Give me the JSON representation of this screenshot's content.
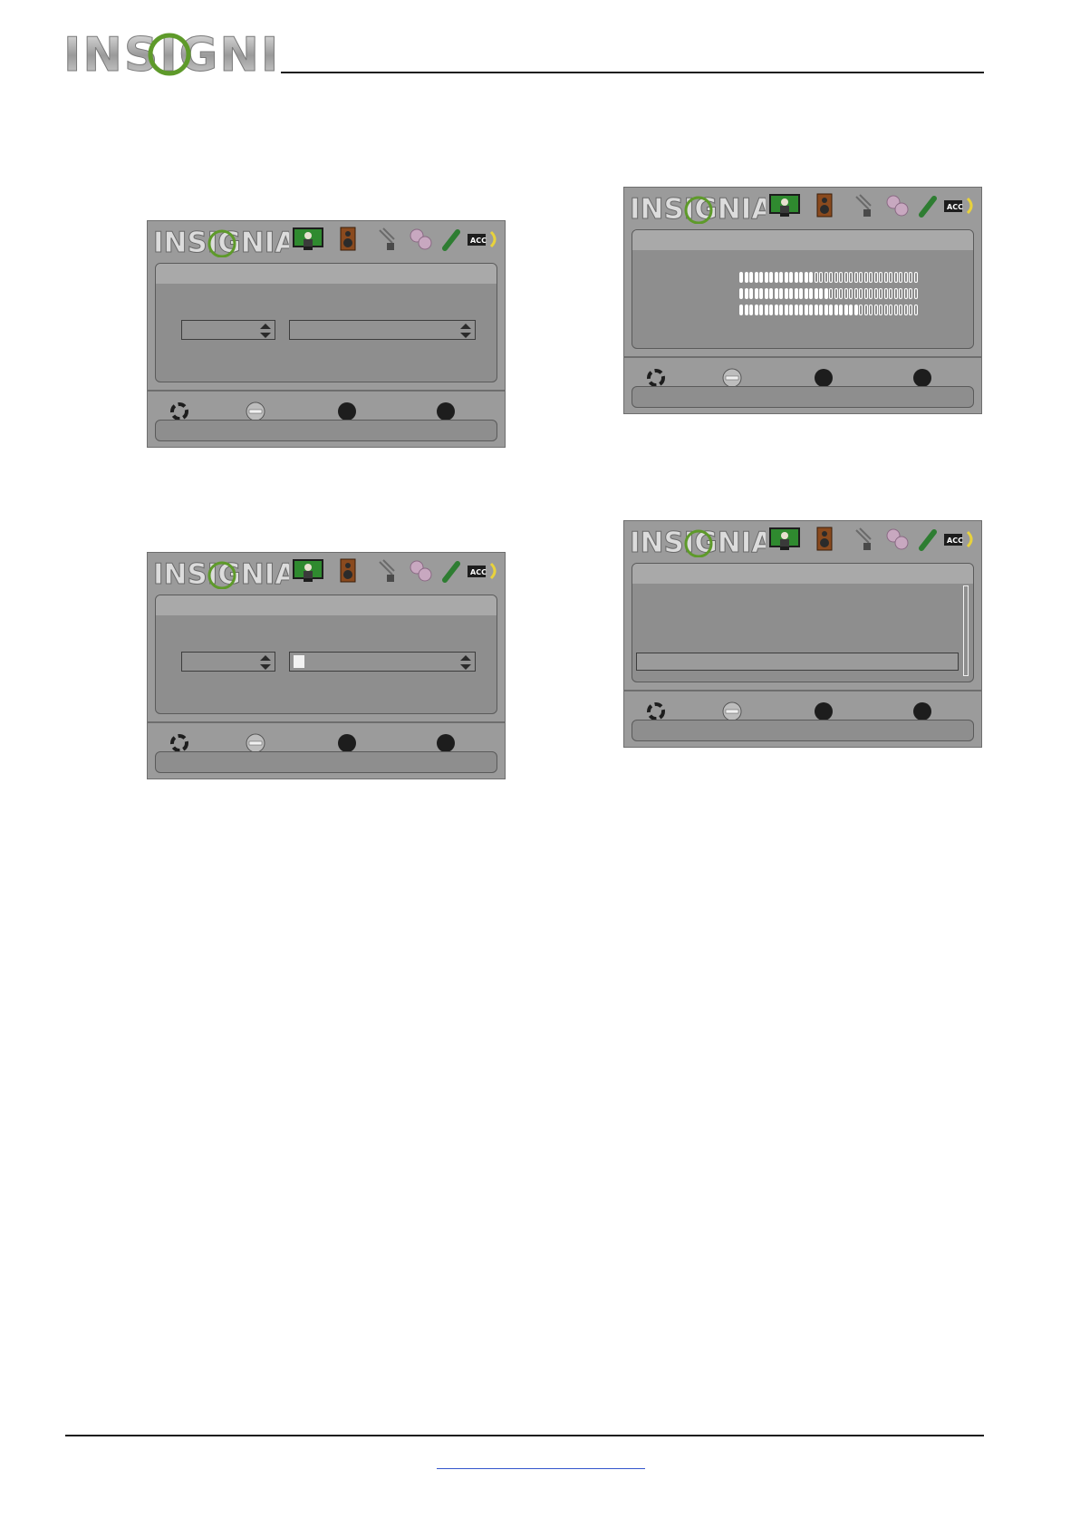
{
  "brand": {
    "name": "INSIGNIA"
  },
  "menu_icons": [
    "picture-icon",
    "audio-speaker-icon",
    "channels-antenna-icon",
    "settings-gears-icon",
    "usb-photos-icon",
    "acc-icon"
  ],
  "acc_label": "ACC",
  "nav_icons": [
    "move-icon",
    "enter-icon",
    "menu-icon",
    "exit-icon"
  ],
  "signal_strength": [
    0.42,
    0.5,
    0.68
  ],
  "footer": {
    "link_text": ""
  },
  "colors": {
    "screen_gray": "#9b9b9b",
    "panel_gray": "#8e8e8e",
    "brand_green": "#5e9a2a",
    "acc_yellow": "#e8d23c"
  }
}
